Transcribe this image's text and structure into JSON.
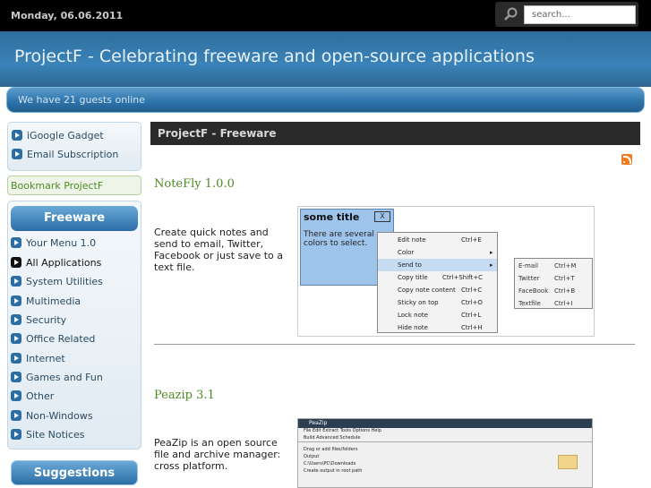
{
  "topbar": {
    "date": "Monday, 06.06.2011",
    "search_placeholder": "search..."
  },
  "header": {
    "title": "ProjectF - Celebrating freeware and open-source applications"
  },
  "guests": "We have 21 guests online",
  "sidebar": {
    "top_links": [
      "iGoogle Gadget",
      "Email Subscription"
    ],
    "bookmark": "Bookmark ProjectF",
    "freeware_header": "Freeware",
    "freeware_items": [
      "Your Menu 1.0",
      "All Applications",
      "System Utilities",
      "Multimedia",
      "Security",
      "Office Related",
      "Internet",
      "Games and Fun",
      "Other",
      "Non-Windows",
      "Site Notices"
    ],
    "suggestions_header": "Suggestions"
  },
  "main": {
    "section_title": "ProjectF - Freeware",
    "articles": [
      {
        "title": "NoteFly 1.0.0",
        "text": "Create quick notes and send to email, Twitter, Facebook or just save to a text file."
      },
      {
        "title": "Peazip 3.1",
        "text": "PeaZip is an open source file and archive manager: cross platform."
      }
    ]
  },
  "notefly_shot": {
    "note_title": "some title",
    "note_close": "X",
    "note_body": "There are several colors to select.",
    "menu": [
      {
        "label": "Edit note",
        "shortcut": "Ctrl+E"
      },
      {
        "label": "Color",
        "shortcut": ""
      },
      {
        "label": "Send to",
        "shortcut": ""
      },
      {
        "label": "Copy title",
        "shortcut": "Ctrl+Shift+C"
      },
      {
        "label": "Copy note content",
        "shortcut": "Ctrl+C"
      },
      {
        "label": "Sticky on top",
        "shortcut": "Ctrl+O"
      },
      {
        "label": "Lock note",
        "shortcut": "Ctrl+L"
      },
      {
        "label": "Hide note",
        "shortcut": "Ctrl+H"
      }
    ],
    "submenu": [
      {
        "label": "E-mail",
        "shortcut": "Ctrl+M"
      },
      {
        "label": "Twitter",
        "shortcut": "Ctrl+T"
      },
      {
        "label": "FaceBook",
        "shortcut": "Ctrl+B"
      },
      {
        "label": "Textfile",
        "shortcut": "Ctrl+I"
      }
    ]
  },
  "peazip_shot": {
    "window_title": "PeaZip",
    "menu": "File   Edit   Extract   Tools   Options   Help",
    "tabs": "Build   Advanced   Schedule",
    "line1": "Drag or add files/folders",
    "line2": "Output",
    "line3": "C:\\Users\\PC\\Downloads",
    "line4": "Create output in root path"
  }
}
